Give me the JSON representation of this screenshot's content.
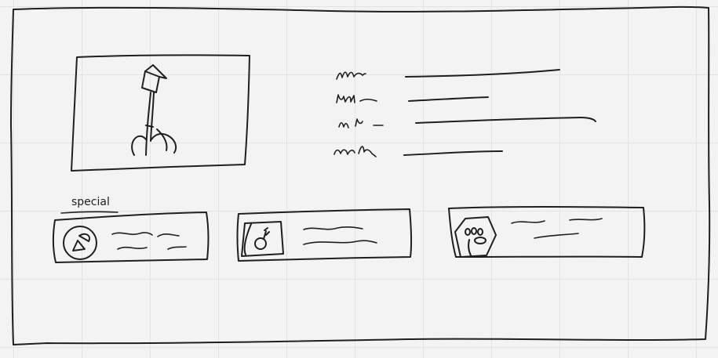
{
  "special_section": {
    "label": "special"
  }
}
